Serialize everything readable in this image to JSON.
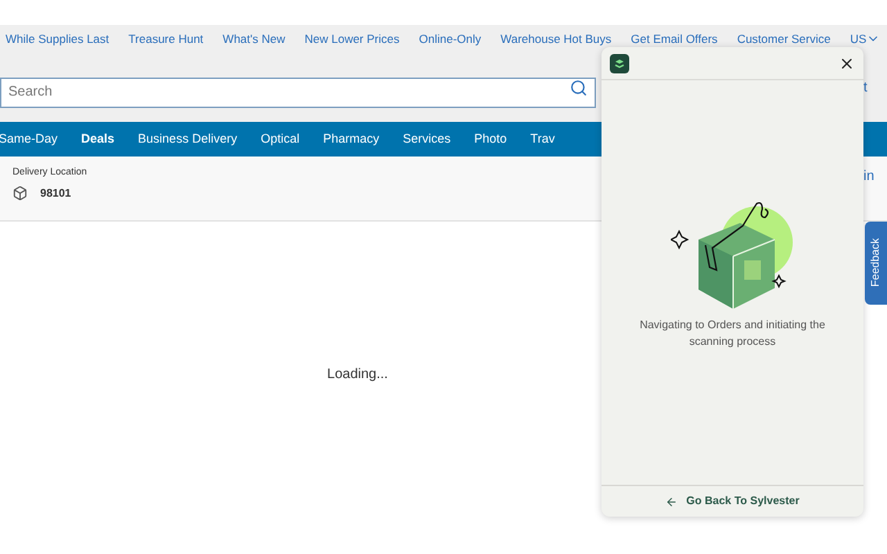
{
  "top_links": [
    "While Supplies Last",
    "Treasure Hunt",
    "What's New",
    "New Lower Prices",
    "Online-Only",
    "Warehouse Hot Buys",
    "Get Email Offers",
    "Customer Service",
    "US"
  ],
  "search": {
    "placeholder": "Search"
  },
  "right_edge_texts": [
    "t",
    "in"
  ],
  "nav": [
    {
      "label": "Same-Day",
      "selected": false
    },
    {
      "label": "Deals",
      "selected": true
    },
    {
      "label": "Business Delivery",
      "selected": false
    },
    {
      "label": "Optical",
      "selected": false
    },
    {
      "label": "Pharmacy",
      "selected": false
    },
    {
      "label": "Services",
      "selected": false
    },
    {
      "label": "Photo",
      "selected": false
    },
    {
      "label": "Trav",
      "selected": false
    }
  ],
  "delivery": {
    "label": "Delivery Location",
    "zip": "98101"
  },
  "loading": "Loading...",
  "panel": {
    "message": "Navigating to Orders and initiating the scanning process",
    "back": "Go Back To Sylvester"
  },
  "feedback": "Feedback"
}
